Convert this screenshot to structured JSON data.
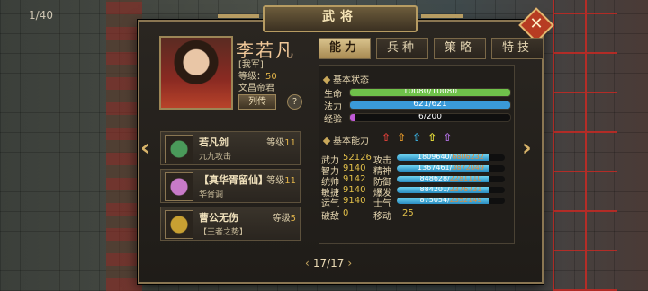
{
  "turn": "1/40",
  "title": "武将",
  "close_label": "✕",
  "hero": {
    "name": "李若凡",
    "faction": "[我军]",
    "level_label": "等级：",
    "level": "50",
    "rank": "文昌帝君",
    "bio_button": "列传",
    "help": "?"
  },
  "tabs": [
    {
      "label": "能力",
      "active": true
    },
    {
      "label": "兵种"
    },
    {
      "label": "策略"
    },
    {
      "label": "特技"
    }
  ],
  "basic": {
    "header": "基本状态",
    "hp": {
      "label": "生命",
      "text": "10080/10080",
      "fraction": 1.0,
      "color": "#6fc24a"
    },
    "mp": {
      "label": "法力",
      "text": "621/621",
      "fraction": 1.0,
      "color": "#3a9ad8"
    },
    "exp": {
      "label": "经验",
      "text": "6/200",
      "fraction": 0.03,
      "color": "#c05ad8"
    }
  },
  "ability": {
    "header": "基本能力",
    "arrows": [
      {
        "glyph": "⇧",
        "color": "#e0403a"
      },
      {
        "glyph": "⇧",
        "color": "#e89a2a"
      },
      {
        "glyph": "⇧",
        "color": "#3ab0e0"
      },
      {
        "glyph": "⇧",
        "color": "#e8e03a"
      },
      {
        "glyph": "⇧",
        "color": "#b070e0"
      }
    ]
  },
  "attributes": [
    {
      "k": "武力",
      "v": "52126",
      "k2": "攻击",
      "cur": "1809640",
      "max": "6806232",
      "fraction": 0.85
    },
    {
      "k": "智力",
      "v": "9140",
      "k2": "精神",
      "cur": "1367461",
      "max": "3872049",
      "fraction": 0.85
    },
    {
      "k": "统帅",
      "v": "9142",
      "k2": "防御",
      "cur": "848628",
      "max": "2281110",
      "fraction": 0.85
    },
    {
      "k": "敏捷",
      "v": "9140",
      "k2": "爆发",
      "cur": "884201",
      "max": "2376731",
      "fraction": 0.85
    },
    {
      "k": "运气",
      "v": "9140",
      "k2": "士气",
      "cur": "875054",
      "max": "2352149",
      "fraction": 0.85
    }
  ],
  "extra": [
    {
      "k": "破敌",
      "v": "0"
    },
    {
      "k": "移动",
      "v": "25"
    }
  ],
  "equipment": [
    {
      "name": "若凡剑",
      "level_label": "等级",
      "level": "11",
      "desc": "九九攻击",
      "icon": "sword-icon",
      "color": "#4a9a5a"
    },
    {
      "name": "【真华胥留仙】",
      "level_label": "等级",
      "level": "11",
      "desc": "华胥调",
      "icon": "robe-icon",
      "color": "#c87ac8"
    },
    {
      "name": "曹公无伤",
      "level_label": "等级",
      "level": "5",
      "desc": "【王者之势】",
      "icon": "seal-icon",
      "color": "#c8a032"
    }
  ],
  "pager": {
    "text": "17/17"
  }
}
